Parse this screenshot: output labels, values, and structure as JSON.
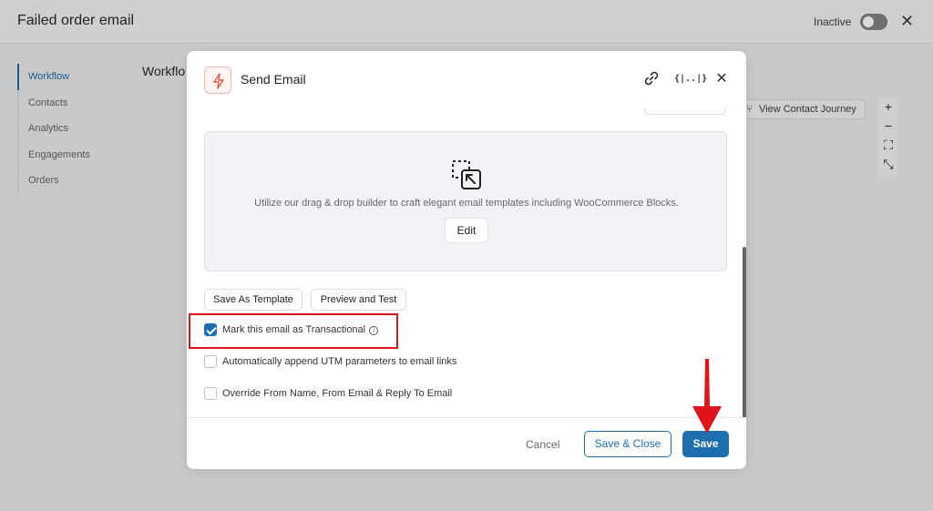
{
  "app": {
    "title": "Failed order email",
    "status_label": "Inactive",
    "close_glyph": "✕"
  },
  "sidebar": {
    "items": [
      {
        "label": "Workflow",
        "active": true
      },
      {
        "label": "Contacts",
        "active": false
      },
      {
        "label": "Analytics",
        "active": false
      },
      {
        "label": "Engagements",
        "active": false
      },
      {
        "label": "Orders",
        "active": false
      }
    ]
  },
  "background": {
    "heading": "Workflo",
    "journey_button": "View Contact Journey",
    "zoom_tools": [
      "+",
      "−",
      "⛶",
      "⤡"
    ]
  },
  "modal": {
    "title": "Send Email",
    "icon": "bolt-icon",
    "header_icons": {
      "link": "link-icon",
      "merge_tags": "{|..|}",
      "close": "✕"
    },
    "builder": {
      "description": "Utilize our drag & drop builder to craft elegant email templates including WooCommerce Blocks.",
      "edit_label": "Edit"
    },
    "buttons": {
      "save_as_template": "Save As Template",
      "preview_and_test": "Preview and Test"
    },
    "options": [
      {
        "label": "Mark this email as Transactional",
        "checked": true,
        "info": "i"
      },
      {
        "label": "Automatically append UTM parameters to email links",
        "checked": false
      },
      {
        "label": "Override From Name, From Email & Reply To Email",
        "checked": false
      }
    ],
    "footer": {
      "cancel": "Cancel",
      "save_close": "Save & Close",
      "save": "Save"
    }
  },
  "colors": {
    "accent": "#1e6fb0",
    "highlight": "#e0141b",
    "arrow": "#e0141b",
    "bolt": "#e2573e"
  }
}
